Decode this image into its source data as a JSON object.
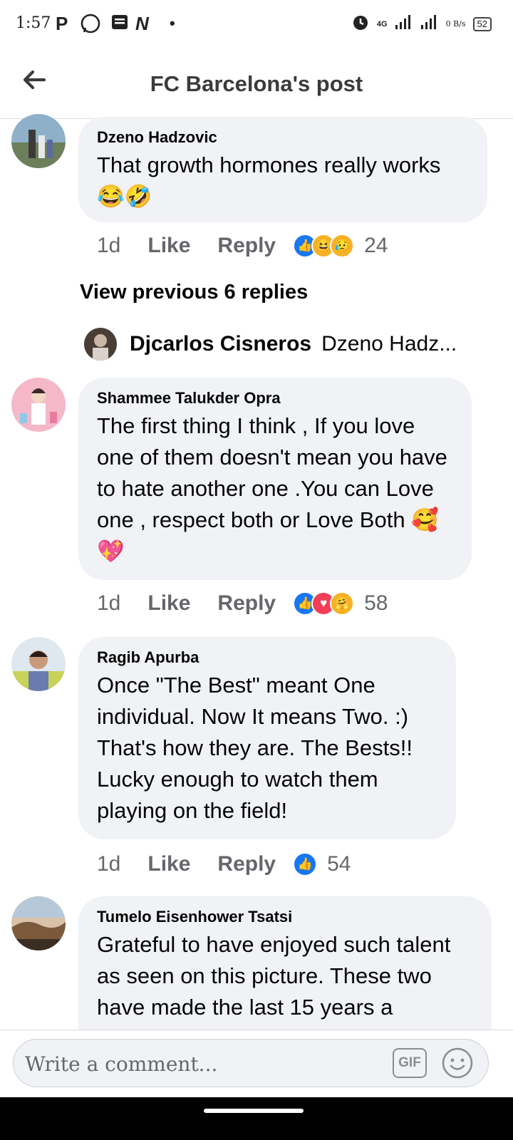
{
  "status_bar": {
    "time": "1:57",
    "network": "4G",
    "speed": "0 B/s",
    "battery": "52",
    "icons": [
      "p-icon",
      "whatsapp-icon",
      "news-icon",
      "n-icon",
      "dot-icon",
      "alarm-icon",
      "signal-icon",
      "signal-icon",
      "battery-icon"
    ]
  },
  "header": {
    "title": "FC Barcelona's post",
    "back_icon": "back-arrow-icon"
  },
  "comments": [
    {
      "author": "Dzeno Hadzovic",
      "text": "That growth hormones really works",
      "emojis": "😂🤣",
      "time": "1d",
      "like_label": "Like",
      "reply_label": "Reply",
      "reactions": [
        "like",
        "haha",
        "sad"
      ],
      "reaction_count": "24"
    },
    {
      "author": "Shammee Talukder Opra",
      "text": "The first thing I think , If you love one of them  doesn't mean you have to hate another one .You can Love one , respect both or Love Both",
      "emojis": "🥰💖",
      "time": "1d",
      "like_label": "Like",
      "reply_label": "Reply",
      "reactions": [
        "like",
        "love",
        "care"
      ],
      "reaction_count": "58"
    },
    {
      "author": "Ragib Apurba",
      "text": "Once \"The Best\" meant One individual. Now It means Two. :) That's how they are. The Bests!! Lucky enough to watch them playing on the field!",
      "time": "1d",
      "like_label": "Like",
      "reply_label": "Reply",
      "reactions": [
        "like"
      ],
      "reaction_count": "54"
    },
    {
      "author": "Tumelo Eisenhower Tsatsi",
      "text": "Grateful to have enjoyed such talent as seen on this picture. These two have made the last 15 years a"
    }
  ],
  "view_previous": "View previous 6 replies",
  "reply_preview": {
    "author": "Djcarlos Cisneros",
    "snippet": "Dzeno Hadz..."
  },
  "composer": {
    "placeholder": "Write a comment...",
    "gif_label": "GIF"
  },
  "colors": {
    "bubble": "#f0f2f5",
    "like_blue": "#1877f2",
    "meta_grey": "#65676b"
  }
}
